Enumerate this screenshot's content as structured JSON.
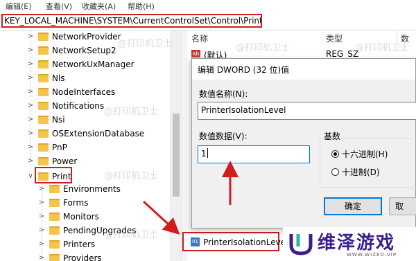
{
  "menu": {
    "items": [
      "编辑(E)",
      "查看(V)",
      "收藏夹(A)",
      "帮助(H)"
    ]
  },
  "address_bar": {
    "path": "KEY_LOCAL_MACHINE\\SYSTEM\\CurrentControlSet\\Control\\Print",
    "prefix": "H"
  },
  "tree": {
    "items": [
      {
        "label": "NetworkProvider"
      },
      {
        "label": "NetworkSetup2"
      },
      {
        "label": "NetworkUxManager"
      },
      {
        "label": "Nls"
      },
      {
        "label": "NodeInterfaces"
      },
      {
        "label": "Notifications"
      },
      {
        "label": "Nsi"
      },
      {
        "label": "OSExtensionDatabase"
      },
      {
        "label": "PnP"
      },
      {
        "label": "Power"
      },
      {
        "label": "Print"
      },
      {
        "label": "Environments"
      },
      {
        "label": "Forms"
      },
      {
        "label": "Monitors"
      },
      {
        "label": "PendingUpgrades"
      },
      {
        "label": "Printers"
      },
      {
        "label": "Providers"
      }
    ]
  },
  "list": {
    "headers": {
      "name": "名称",
      "type": "类型",
      "data": "数"
    },
    "rows": [
      {
        "name": "(默认)",
        "type": "REG_SZ",
        "icon": "ab"
      },
      {
        "name": "PrinterIsolationLevel",
        "icon": "bin"
      }
    ]
  },
  "dialog": {
    "title": "编辑 DWORD (32 位)值",
    "name_label": "数值名称(N):",
    "name_value": "PrinterIsolationLevel",
    "data_label": "数值数据(V):",
    "data_value": "1",
    "base_label": "基数",
    "radio_hex": "十六进制(H)",
    "radio_dec": "十进制(D)",
    "ok_label": "确定",
    "cancel_label": "取"
  },
  "watermark": "@打印机卫士",
  "brand": {
    "name": "维泽游戏",
    "sub": "WWW.WIZED.VIP"
  },
  "colors": {
    "highlight": "#d01c1c",
    "folder": "#f4c54a",
    "accent": "#0078d7",
    "brand": "#3b1e8f"
  }
}
